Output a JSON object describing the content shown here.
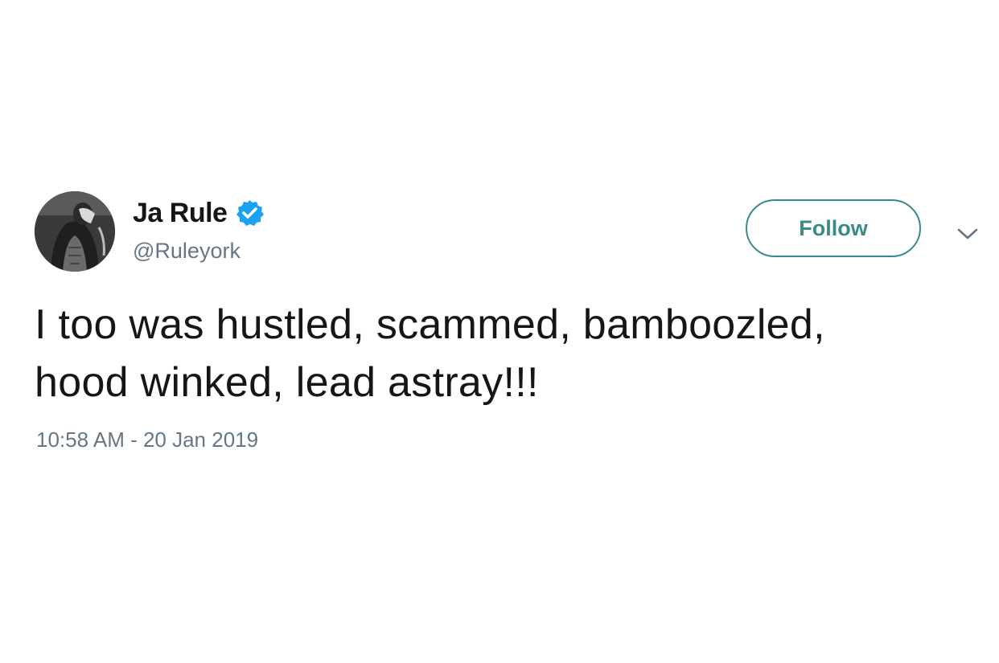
{
  "author": {
    "display_name": "Ja Rule",
    "handle": "@Ruleyork",
    "verified": true,
    "verified_icon": "verified-badge-icon",
    "avatar_icon": "avatar-photo"
  },
  "actions": {
    "follow_label": "Follow",
    "menu_icon": "chevron-down-icon"
  },
  "tweet": {
    "text_lines": [
      "I too was hustled, scammed, bamboozled,",
      "hood winked, lead astray!!!"
    ],
    "timestamp": "10:58 AM - 20 Jan 2019"
  },
  "colors": {
    "text": "#14171a",
    "muted": "#657786",
    "verified_blue": "#1da1f2",
    "follow_accent": "#3a8a8a"
  }
}
